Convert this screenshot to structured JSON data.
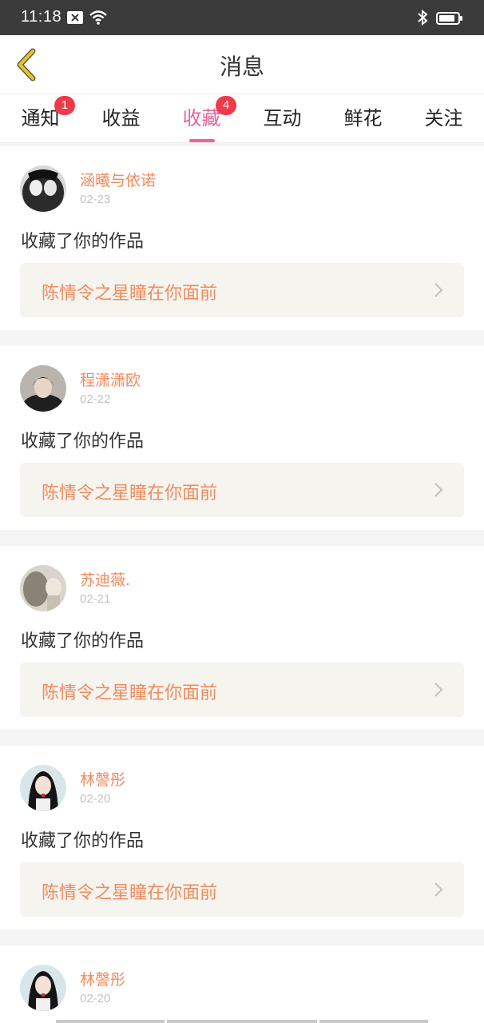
{
  "status_bar": {
    "time": "11:18",
    "icons": [
      "notification-x-icon",
      "wifi-icon",
      "bluetooth-icon",
      "battery-icon"
    ]
  },
  "header": {
    "title": "消息",
    "back_icon": "chevron-left-icon",
    "back_icon_color": "#e5c43a"
  },
  "tabs": [
    {
      "label": "通知",
      "badge": "1",
      "active": false
    },
    {
      "label": "收益",
      "badge": "",
      "active": false
    },
    {
      "label": "收藏",
      "badge": "4",
      "active": true
    },
    {
      "label": "互动",
      "badge": "",
      "active": false
    },
    {
      "label": "鲜花",
      "badge": "",
      "active": false
    },
    {
      "label": "关注",
      "badge": "",
      "active": false
    }
  ],
  "colors": {
    "accent": "#e8649c",
    "username": "#f08b5e",
    "badge": "#ef3a4a"
  },
  "feed": [
    {
      "username": "涵曦与依诺",
      "date": "02-23",
      "action": "收藏了你的作品",
      "work_title": "陈情令之星瞳在你面前"
    },
    {
      "username": "程潇潇欧",
      "date": "02-22",
      "action": "收藏了你的作品",
      "work_title": "陈情令之星瞳在你面前"
    },
    {
      "username": "苏迪薇.",
      "date": "02-21",
      "action": "收藏了你的作品",
      "work_title": "陈情令之星瞳在你面前"
    },
    {
      "username": "林謦彤",
      "date": "02-20",
      "action": "收藏了你的作品",
      "work_title": "陈情令之星瞳在你面前"
    },
    {
      "username": "林謦彤",
      "date": "02-20",
      "action": "",
      "work_title": ""
    }
  ]
}
